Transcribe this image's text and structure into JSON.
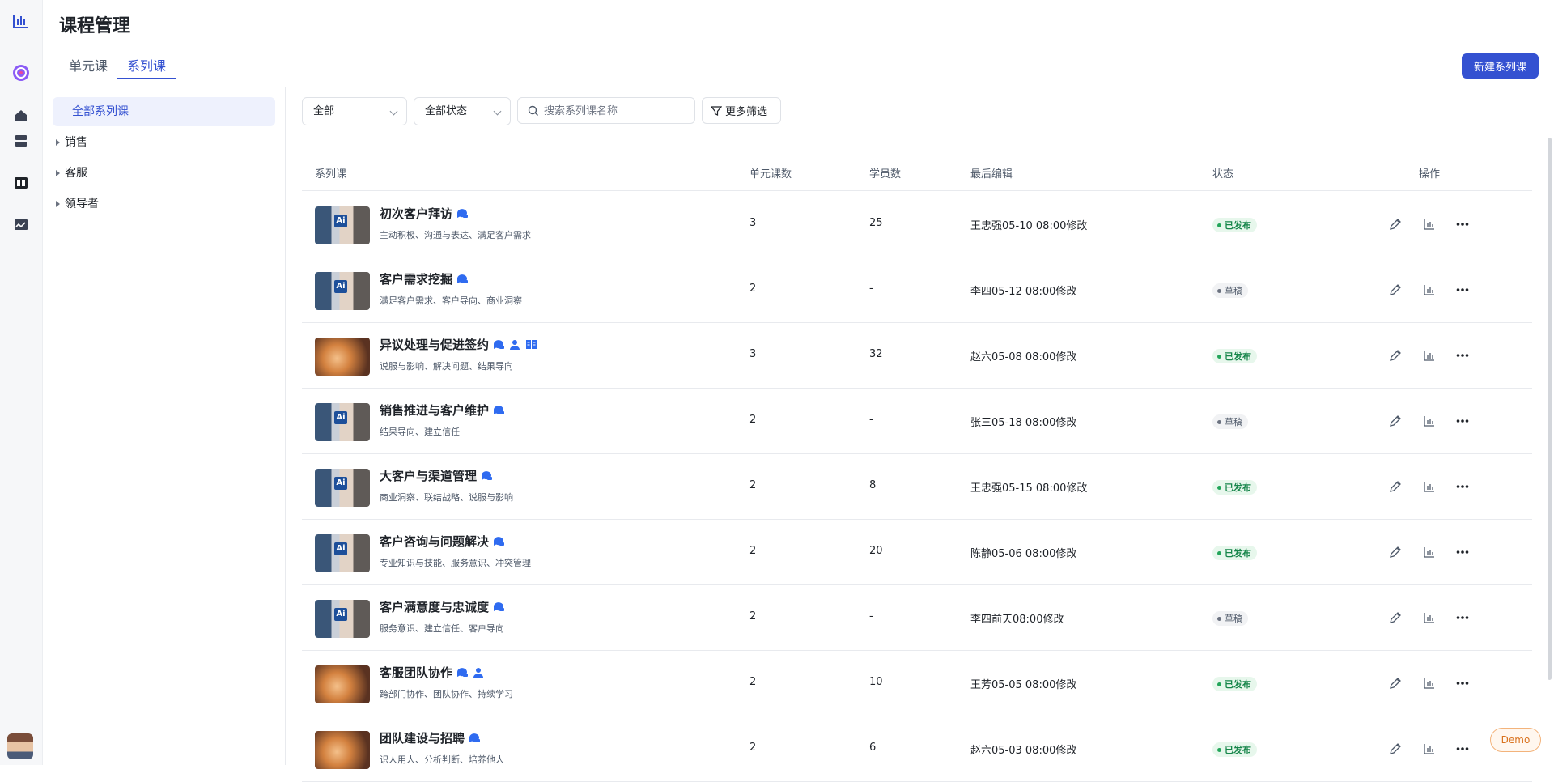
{
  "page": {
    "title": "课程管理"
  },
  "tabs": [
    {
      "label": "单元课"
    },
    {
      "label": "系列课"
    }
  ],
  "actions": {
    "new_series": "新建系列课"
  },
  "categories": {
    "all": "全部系列课",
    "items": [
      {
        "label": "销售"
      },
      {
        "label": "客服"
      },
      {
        "label": "领导者"
      }
    ]
  },
  "filters": {
    "category": "全部",
    "status": "全部状态",
    "search_placeholder": "搜索系列课名称",
    "more": "更多筛选"
  },
  "table": {
    "columns": {
      "course": "系列课",
      "units": "单元课数",
      "students": "学员数",
      "last_edit": "最后编辑",
      "status": "状态",
      "ops": "操作"
    },
    "rows": [
      {
        "name": "初次客户拜访",
        "tags": "主动积极、沟通与表达、满足客户需求",
        "units": "3",
        "students": "25",
        "edited": "王忠强05-10 08:00修改",
        "status": "已发布"
      },
      {
        "name": "客户需求挖掘",
        "tags": "满足客户需求、客户导向、商业洞察",
        "units": "2",
        "students": "-",
        "edited": "李四05-12 08:00修改",
        "status": "草稿"
      },
      {
        "name": "异议处理与促进签约",
        "tags": "说服与影响、解决问题、结果导向",
        "units": "3",
        "students": "32",
        "edited": "赵六05-08 08:00修改",
        "status": "已发布"
      },
      {
        "name": "销售推进与客户维护",
        "tags": "结果导向、建立信任",
        "units": "2",
        "students": "-",
        "edited": "张三05-18 08:00修改",
        "status": "草稿"
      },
      {
        "name": "大客户与渠道管理",
        "tags": "商业洞察、联结战略、说服与影响",
        "units": "2",
        "students": "8",
        "edited": "王忠强05-15 08:00修改",
        "status": "已发布"
      },
      {
        "name": "客户咨询与问题解决",
        "tags": "专业知识与技能、服务意识、冲突管理",
        "units": "2",
        "students": "20",
        "edited": "陈静05-06 08:00修改",
        "status": "已发布"
      },
      {
        "name": "客户满意度与忠诚度",
        "tags": "服务意识、建立信任、客户导向",
        "units": "2",
        "students": "-",
        "edited": "李四前天08:00修改",
        "status": "草稿"
      },
      {
        "name": "客服团队协作",
        "tags": "跨部门协作、团队协作、持续学习",
        "units": "2",
        "students": "10",
        "edited": "王芳05-05 08:00修改",
        "status": "已发布"
      },
      {
        "name": "团队建设与招聘",
        "tags": "识人用人、分析判断、培养他人",
        "units": "2",
        "students": "6",
        "edited": "赵六05-03 08:00修改",
        "status": "已发布"
      }
    ]
  },
  "demo_label": "Demo",
  "colors": {
    "accent": "#3451d1",
    "published": "#18864b",
    "draft": "#4e5969"
  }
}
